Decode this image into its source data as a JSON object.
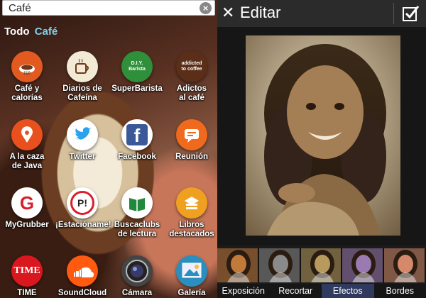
{
  "search": {
    "query": "Café"
  },
  "filters": {
    "all": "Todo",
    "current": "Café"
  },
  "apps": [
    {
      "label_1": "Café y",
      "label_2": "calorías",
      "icon": "coffee-cup-icon",
      "color": "#e35a20"
    },
    {
      "label_1": "Diarios de",
      "label_2": "Cafeína",
      "icon": "coffee-mug-icon",
      "color": "#f3ead6"
    },
    {
      "label_1": "SuperBarista",
      "label_2": "",
      "icon": "barista-icon",
      "color": "#2f8f3a",
      "badge": "D.I.Y. Barista"
    },
    {
      "label_1": "Adictos",
      "label_2": "al café",
      "icon": "addicted-to-coffee-icon",
      "color": "#5a2e18",
      "badge": "addicted to coffee"
    },
    {
      "label_1": "A la caza",
      "label_2": "de Java",
      "icon": "map-pin-icon",
      "color": "#e8501e"
    },
    {
      "label_1": "Twitter",
      "label_2": "",
      "icon": "twitter-bird-icon",
      "color": "#ffffff"
    },
    {
      "label_1": "Facebook",
      "label_2": "",
      "icon": "facebook-icon",
      "color": "#ffffff",
      "badge": "f"
    },
    {
      "label_1": "Reunión",
      "label_2": "",
      "icon": "chat-bubble-icon",
      "color": "#ef6a1c"
    },
    {
      "label_1": "MyGrubber",
      "label_2": "",
      "icon": "mygrubber-icon",
      "color": "#ffffff",
      "badge": "G"
    },
    {
      "label_1": "¡Estacióname!",
      "label_2": "",
      "icon": "parking-icon",
      "color": "#ffffff",
      "badge": "P!"
    },
    {
      "label_1": "Buscaclubs",
      "label_2": "de lectura",
      "icon": "book-icon",
      "color": "#ffffff"
    },
    {
      "label_1": "Libros",
      "label_2": "destacados",
      "icon": "books-stack-icon",
      "color": "#f0a020"
    },
    {
      "label_1": "TIME",
      "label_2": "",
      "icon": "time-magazine-icon",
      "color": "#d9171e",
      "badge": "TIME"
    },
    {
      "label_1": "SoundCloud",
      "label_2": "",
      "icon": "soundcloud-icon",
      "color": "#ff5a10"
    },
    {
      "label_1": "Cámara",
      "label_2": "",
      "icon": "camera-icon",
      "color": "#444444"
    },
    {
      "label_1": "Galería",
      "label_2": "",
      "icon": "gallery-icon",
      "color": "#2a8fbf"
    }
  ],
  "editor": {
    "title": "Editar",
    "tabs": [
      "Exposición",
      "Recortar",
      "Efectos",
      "Bordes"
    ],
    "active_tab": "Efectos",
    "thumb_tints": [
      "#c27a3a",
      "#8a8a8a",
      "#b89a5c",
      "#9a7ab0",
      "#d48a6a"
    ],
    "accent": "#2f3a5e"
  }
}
